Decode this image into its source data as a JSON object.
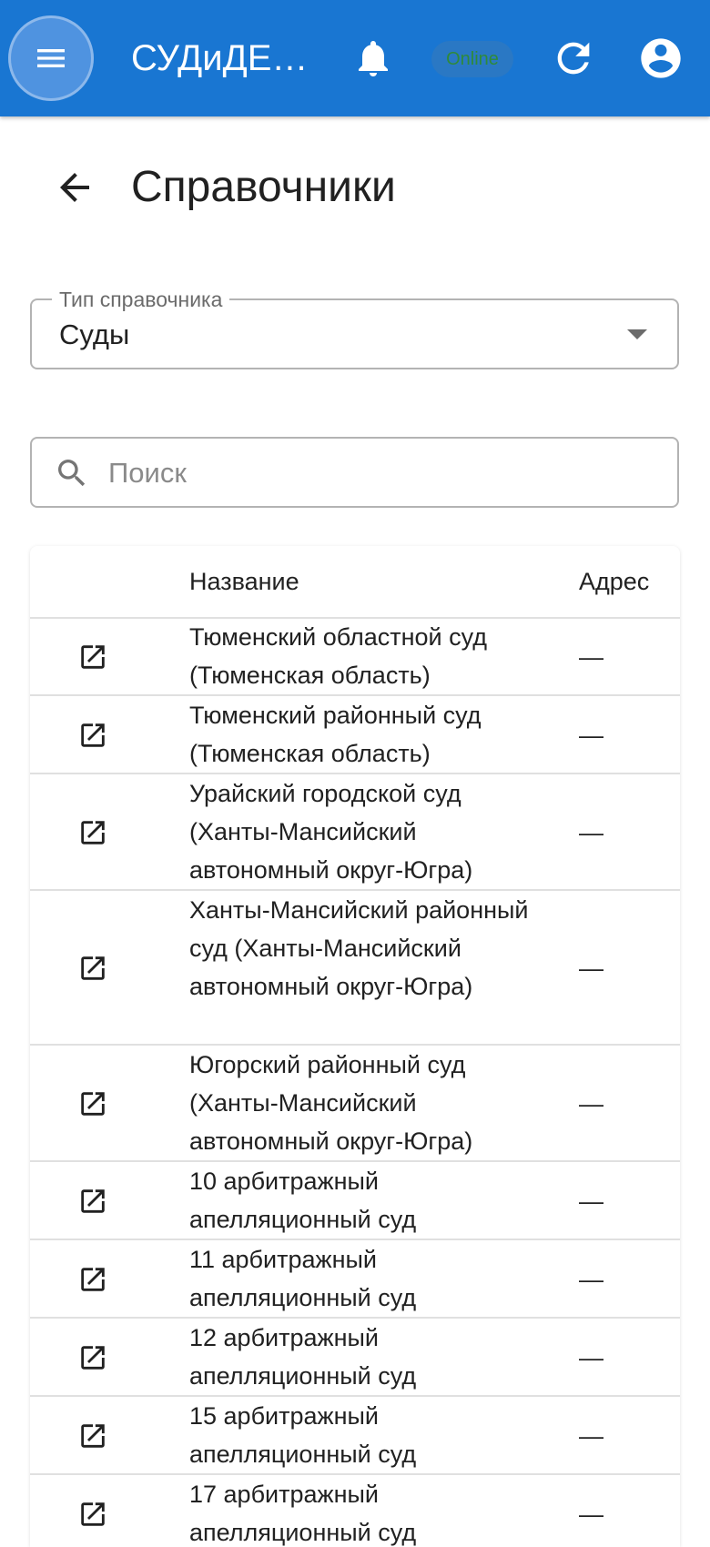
{
  "appbar": {
    "title": "СУДиДЕЛО",
    "status": "Online",
    "colors": {
      "primary": "#1976d2",
      "status_text": "#2f8a3a"
    }
  },
  "page": {
    "title": "Справочники"
  },
  "dictionary_select": {
    "label": "Тип справочника",
    "value": "Суды"
  },
  "search": {
    "placeholder": "Поиск",
    "value": ""
  },
  "table": {
    "columns": [
      "",
      "Название",
      "Адрес"
    ],
    "rows": [
      {
        "name": "Тюменский областной суд (Тюменская область)",
        "address": "—"
      },
      {
        "name": "Тюменский районный суд (Тюменская область)",
        "address": "—"
      },
      {
        "name": "Урайский городской суд (Ханты-Мансийский автономный округ-Югра)",
        "address": "—"
      },
      {
        "name": "Ханты-Мансийский районный суд (Ханты-Мансийский автономный округ-Югра)",
        "address": "—"
      },
      {
        "name": "Югорский районный суд (Ханты-Мансийский автономный округ-Югра)",
        "address": "—"
      },
      {
        "name": "10 арбитражный апелляционный суд",
        "address": "—"
      },
      {
        "name": "11 арбитражный апелляционный суд",
        "address": "—"
      },
      {
        "name": "12 арбитражный апелляционный суд",
        "address": "—"
      },
      {
        "name": "15 арбитражный апелляционный суд",
        "address": "—"
      },
      {
        "name": "17 арбитражный апелляционный суд",
        "address": "—"
      }
    ]
  }
}
